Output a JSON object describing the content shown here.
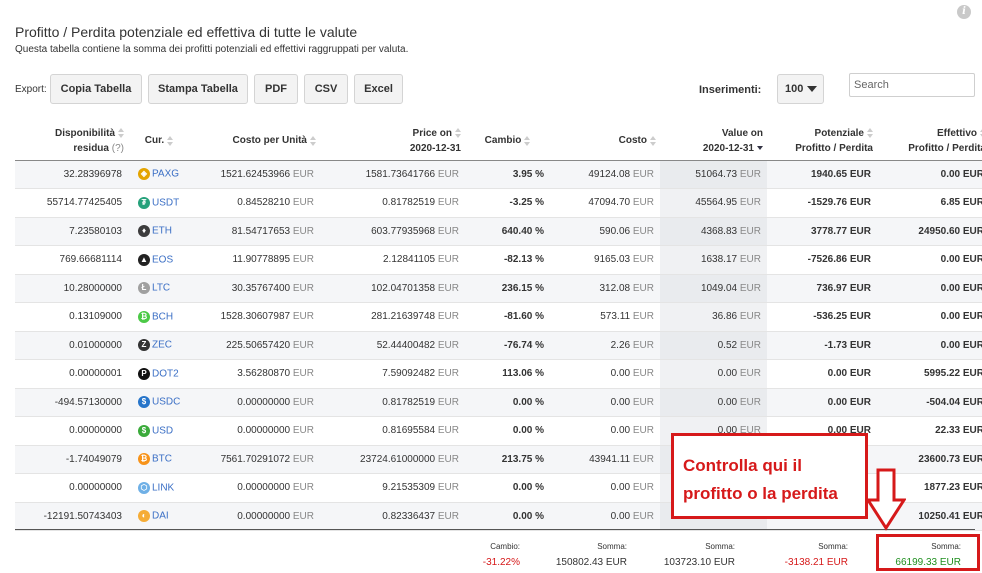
{
  "title": "Profitto / Perdita potenziale ed effettiva di tutte le valute",
  "subtitle": "Questa tabella contiene la somma dei profitti potenziali ed effettivi raggruppati per valuta.",
  "toolbar": {
    "export_label": "Export:",
    "copy_label": "Copia Tabella",
    "print_label": "Stampa Tabella",
    "pdf_label": "PDF",
    "csv_label": "CSV",
    "excel_label": "Excel",
    "entries_label": "Inserimenti:",
    "entries_value": "100",
    "search_placeholder": "Search"
  },
  "columns": {
    "availability_l1": "Disponibilità",
    "availability_l2": "residua",
    "availability_q": "(?)",
    "cur": "Cur.",
    "cost_per_unit": "Costo per Unità",
    "price_l1": "Price on",
    "price_l2": "2020-12-31",
    "change": "Cambio",
    "cost": "Costo",
    "value_l1": "Value on",
    "value_l2": "2020-12-31",
    "potential_l1": "Potenziale",
    "potential_l2": "Profitto / Perdita",
    "effective_l1": "Effettivo",
    "effective_l2": "Profitto / Perdita"
  },
  "unit": "EUR",
  "rows": [
    {
      "avail": "32.28396978",
      "cur": "PAXG",
      "icon": "paxg-icon",
      "color": "#e4a400",
      "glyph": "◈",
      "cpu": "1521.62453966",
      "price": "1581.73641766",
      "change": "3.95 %",
      "change_cls": "pos",
      "cost": "49124.08",
      "value": "51064.73",
      "pot": "1940.65 EUR",
      "pot_cls": "pos",
      "eff": "0.00 EUR",
      "eff_cls": "zero"
    },
    {
      "avail": "55714.77425405",
      "cur": "USDT",
      "icon": "usdt-icon",
      "color": "#26a17b",
      "glyph": "₮",
      "cpu": "0.84528210",
      "price": "0.81782519",
      "change": "-3.25 %",
      "change_cls": "neg",
      "cost": "47094.70",
      "value": "45564.95",
      "pot": "-1529.76 EUR",
      "pot_cls": "neg",
      "eff": "6.85 EUR",
      "eff_cls": "pos"
    },
    {
      "avail": "7.23580103",
      "cur": "ETH",
      "icon": "eth-icon",
      "color": "#3c3c3d",
      "glyph": "♦",
      "cpu": "81.54717653",
      "price": "603.77935968",
      "change": "640.40 %",
      "change_cls": "pos",
      "cost": "590.06",
      "value": "4368.83",
      "pot": "3778.77 EUR",
      "pot_cls": "pos",
      "eff": "24950.60 EUR",
      "eff_cls": "pos"
    },
    {
      "avail": "769.66681114",
      "cur": "EOS",
      "icon": "eos-icon",
      "color": "#222222",
      "glyph": "▲",
      "cpu": "11.90778895",
      "price": "2.12841105",
      "change": "-82.13 %",
      "change_cls": "neg",
      "cost": "9165.03",
      "value": "1638.17",
      "pot": "-7526.86 EUR",
      "pot_cls": "neg",
      "eff": "0.00 EUR",
      "eff_cls": "zero"
    },
    {
      "avail": "10.28000000",
      "cur": "LTC",
      "icon": "ltc-icon",
      "color": "#a0a0a0",
      "glyph": "Ł",
      "cpu": "30.35767400",
      "price": "102.04701358",
      "change": "236.15 %",
      "change_cls": "pos",
      "cost": "312.08",
      "value": "1049.04",
      "pot": "736.97 EUR",
      "pot_cls": "pos",
      "eff": "0.00 EUR",
      "eff_cls": "zero"
    },
    {
      "avail": "0.13109000",
      "cur": "BCH",
      "icon": "bch-icon",
      "color": "#4cc947",
      "glyph": "₿",
      "cpu": "1528.30607987",
      "price": "281.21639748",
      "change": "-81.60 %",
      "change_cls": "neg",
      "cost": "573.11",
      "value": "36.86",
      "pot": "-536.25 EUR",
      "pot_cls": "neg",
      "eff": "0.00 EUR",
      "eff_cls": "zero"
    },
    {
      "avail": "0.01000000",
      "cur": "ZEC",
      "icon": "zec-icon",
      "color": "#333333",
      "glyph": "Z",
      "cpu": "225.50657420",
      "price": "52.44400482",
      "change": "-76.74 %",
      "change_cls": "neg",
      "cost": "2.26",
      "value": "0.52",
      "pot": "-1.73 EUR",
      "pot_cls": "neg",
      "eff": "0.00 EUR",
      "eff_cls": "zero"
    },
    {
      "avail": "0.00000001",
      "cur": "DOT2",
      "icon": "dot-icon",
      "color": "#111111",
      "glyph": "P",
      "cpu": "3.56280870",
      "price": "7.59092482",
      "change": "113.06 %",
      "change_cls": "pos",
      "cost": "0.00",
      "value": "0.00",
      "pot": "0.00 EUR",
      "pot_cls": "zero",
      "eff": "5995.22 EUR",
      "eff_cls": "pos"
    },
    {
      "avail": "-494.57130000",
      "cur": "USDC",
      "icon": "usdc-icon",
      "color": "#2775ca",
      "glyph": "$",
      "cpu": "0.00000000",
      "price": "0.81782519",
      "change": "0.00 %",
      "change_cls": "zero",
      "cost": "0.00",
      "value": "0.00",
      "pot": "0.00 EUR",
      "pot_cls": "zero",
      "eff": "-504.04 EUR",
      "eff_cls": "neg"
    },
    {
      "avail": "0.00000000",
      "cur": "USD",
      "icon": "usd-icon",
      "color": "#3bab3b",
      "glyph": "$",
      "cpu": "0.00000000",
      "price": "0.81695584",
      "change": "0.00 %",
      "change_cls": "zero",
      "cost": "0.00",
      "value": "0.00",
      "pot": "0.00 EUR",
      "pot_cls": "zero",
      "eff": "22.33 EUR",
      "eff_cls": "pos"
    },
    {
      "avail": "-1.74049079",
      "cur": "BTC",
      "icon": "btc-icon",
      "color": "#f7931a",
      "glyph": "₿",
      "cpu": "7561.70291072",
      "price": "23724.61000000",
      "change": "213.75 %",
      "change_cls": "pos",
      "cost": "43941.11",
      "value": "",
      "pot": "",
      "pot_cls": "pos",
      "eff": "23600.73 EUR",
      "eff_cls": "pos"
    },
    {
      "avail": "0.00000000",
      "cur": "LINK",
      "icon": "link-icon",
      "color": "#6fb0e6",
      "glyph": "⬡",
      "cpu": "0.00000000",
      "price": "9.21535309",
      "change": "0.00 %",
      "change_cls": "zero",
      "cost": "0.00",
      "value": "",
      "pot": "",
      "pot_cls": "zero",
      "eff": "1877.23 EUR",
      "eff_cls": "pos"
    },
    {
      "avail": "-12191.50743403",
      "cur": "DAI",
      "icon": "dai-icon",
      "color": "#f5ac37",
      "glyph": "◐",
      "cpu": "0.00000000",
      "price": "0.82336437",
      "change": "0.00 %",
      "change_cls": "zero",
      "cost": "0.00",
      "value": "",
      "pot": "",
      "pot_cls": "zero",
      "eff": "10250.41 EUR",
      "eff_cls": "pos"
    }
  ],
  "footer": {
    "change_label": "Cambio:",
    "change_value": "-31.22%",
    "cost_label": "Somma:",
    "cost_value": "150802.43 EUR",
    "value_label": "Somma:",
    "value_value": "103723.10 EUR",
    "pot_label": "Somma:",
    "pot_value": "-3138.21 EUR",
    "eff_label": "Somma:",
    "eff_value": "66199.33 EUR"
  },
  "annotation": {
    "line1": "Controlla qui il",
    "line2": "profitto o la perdita",
    "color": "#d6191a"
  }
}
